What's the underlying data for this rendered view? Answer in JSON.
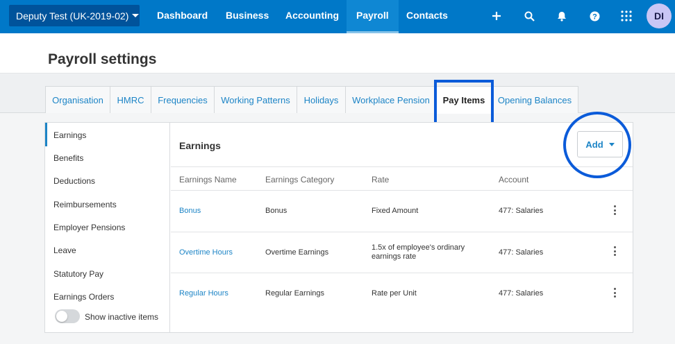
{
  "topnav": {
    "org": "Deputy Test (UK-2019-02)",
    "links": [
      "Dashboard",
      "Business",
      "Accounting",
      "Payroll",
      "Contacts"
    ],
    "active": "Payroll",
    "icons": [
      "plus-icon",
      "search-icon",
      "bell-icon",
      "help-icon",
      "apps-grid-icon"
    ],
    "avatar": "DI",
    "colors": {
      "bar": "#0078c8",
      "org": "#00539b",
      "avatar": "#c9c6f5"
    }
  },
  "page": {
    "title": "Payroll settings"
  },
  "tabs": [
    "Organisation",
    "HMRC",
    "Frequencies",
    "Working Patterns",
    "Holidays",
    "Workplace Pension",
    "Pay Items",
    "Opening Balances"
  ],
  "active_tab": "Pay Items",
  "sidebar": {
    "items": [
      "Earnings",
      "Benefits",
      "Deductions",
      "Reimbursements",
      "Employer Pensions",
      "Leave",
      "Statutory Pay",
      "Earnings Orders"
    ],
    "active": "Earnings",
    "toggle_label": "Show inactive items"
  },
  "content": {
    "title": "Earnings",
    "add_label": "Add",
    "columns": [
      "Earnings Name",
      "Earnings Category",
      "Rate",
      "Account"
    ],
    "rows": [
      {
        "name": "Bonus",
        "category": "Bonus",
        "rate": "Fixed Amount",
        "rate2": "",
        "account": "477: Salaries"
      },
      {
        "name": "Overtime Hours",
        "category": "Overtime Earnings",
        "rate": "1.5x of employee's ordinary",
        "rate2": "earnings rate",
        "account": "477: Salaries"
      },
      {
        "name": "Regular Hours",
        "category": "Regular Earnings",
        "rate": "Rate per Unit",
        "rate2": "",
        "account": "477: Salaries"
      }
    ]
  },
  "highlight_color": "#0b5bd9"
}
